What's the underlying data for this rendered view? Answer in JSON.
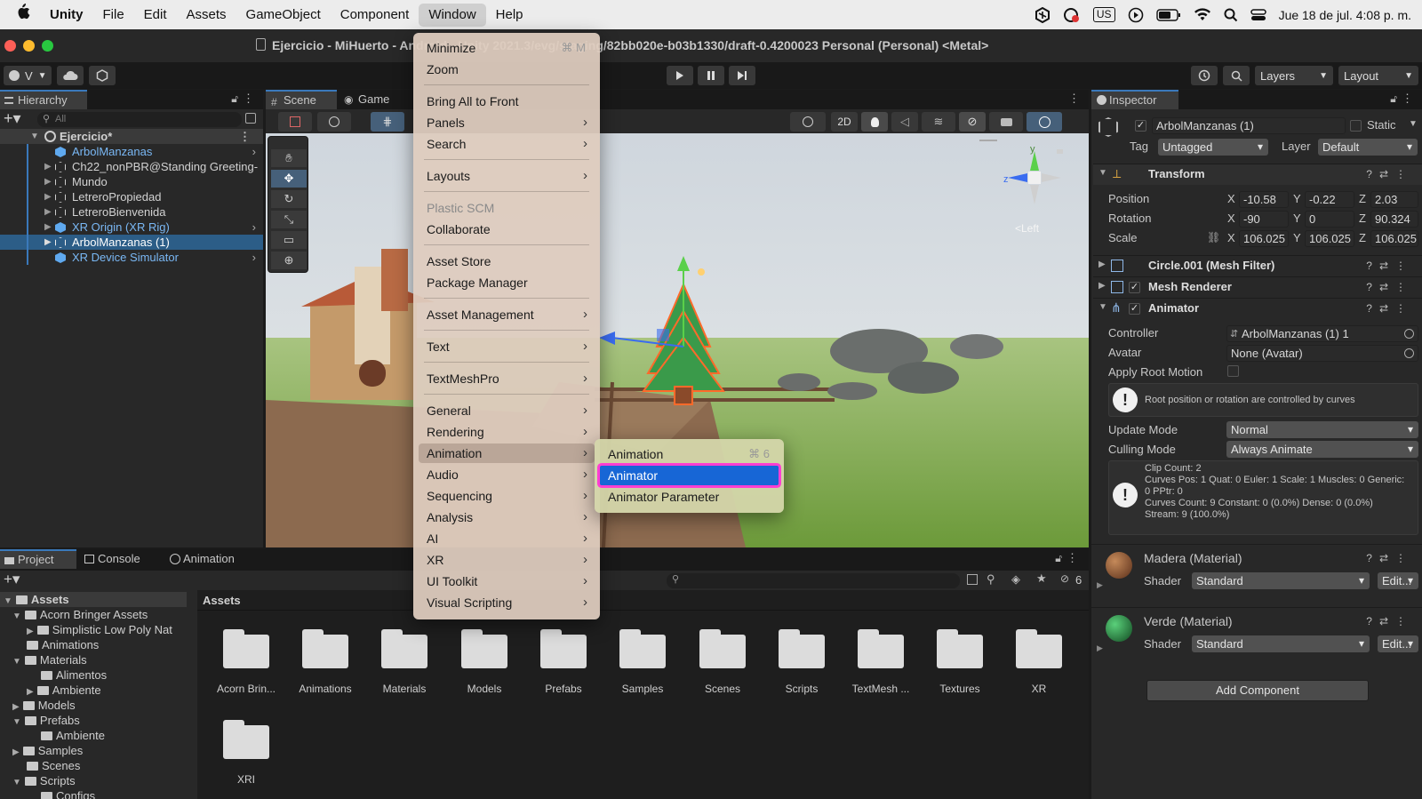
{
  "menubar": {
    "apple": "",
    "app": "Unity",
    "items": [
      "File",
      "Edit",
      "Assets",
      "GameObject",
      "Component",
      "Window",
      "Help"
    ],
    "keyboard": "US",
    "datetime": "Jue 18 de jul.  4:08 p. m."
  },
  "window": {
    "title": "Ejercicio - MiHuerto - Android - Unity 2021.3/evg/staging/82bb020e-b03b1330/draft-0.4200023 Personal (Personal) <Metal>"
  },
  "toolbar": {
    "account": "V",
    "layers": "Layers",
    "layout": "Layout"
  },
  "hierarchy": {
    "tab": "Hierarchy",
    "search_placeholder": "All",
    "scene": "Ejercicio*",
    "items": [
      {
        "label": "ArbolManzanas"
      },
      {
        "label": "Ch22_nonPBR@Standing Greeting-"
      },
      {
        "label": "Mundo"
      },
      {
        "label": "LetreroPropiedad"
      },
      {
        "label": "LetreroBienvenida"
      },
      {
        "label": "XR Origin (XR Rig)"
      },
      {
        "label": "ArbolManzanas (1)"
      },
      {
        "label": "XR Device Simulator"
      }
    ]
  },
  "scene_tabs": {
    "scene": "Scene",
    "game": "Game",
    "mode_2d": "2D",
    "gizmo_left": "<Left",
    "gizmo_y": "y",
    "gizmo_z": "z"
  },
  "window_menu": {
    "items": [
      {
        "label": "Minimize",
        "shortcut": "⌘ M"
      },
      {
        "label": "Zoom"
      },
      {
        "label": "Bring All to Front"
      },
      {
        "label": "Panels"
      },
      {
        "label": "Search"
      },
      {
        "label": "Layouts"
      },
      {
        "label": "Plastic SCM"
      },
      {
        "label": "Collaborate"
      },
      {
        "label": "Asset Store"
      },
      {
        "label": "Package Manager"
      },
      {
        "label": "Asset Management"
      },
      {
        "label": "Text"
      },
      {
        "label": "TextMeshPro"
      },
      {
        "label": "General"
      },
      {
        "label": "Rendering"
      },
      {
        "label": "Animation"
      },
      {
        "label": "Audio"
      },
      {
        "label": "Sequencing"
      },
      {
        "label": "Analysis"
      },
      {
        "label": "AI"
      },
      {
        "label": "XR"
      },
      {
        "label": "UI Toolkit"
      },
      {
        "label": "Visual Scripting"
      }
    ]
  },
  "animation_submenu": {
    "items": [
      {
        "label": "Animation",
        "shortcut": "⌘ 6"
      },
      {
        "label": "Animator"
      },
      {
        "label": "Animator Parameter"
      }
    ],
    "highlight_color": "#ff3ed2"
  },
  "inspector": {
    "tab": "Inspector",
    "object_name": "ArbolManzanas (1)",
    "static_label": "Static",
    "tag_label": "Tag",
    "tag_value": "Untagged",
    "layer_label": "Layer",
    "layer_value": "Default",
    "transform": {
      "title": "Transform",
      "position_label": "Position",
      "rotation_label": "Rotation",
      "scale_label": "Scale",
      "position": [
        "-10.58",
        "-0.22",
        "2.03"
      ],
      "rotation": [
        "-90",
        "0",
        "90.324"
      ],
      "scale": [
        "106.025",
        "106.025",
        "106.025"
      ],
      "axes": [
        "X",
        "Y",
        "Z"
      ]
    },
    "mesh_filter": "Circle.001 (Mesh Filter)",
    "mesh_renderer": "Mesh Renderer",
    "animator": {
      "title": "Animator",
      "controller_label": "Controller",
      "controller_value": "ArbolManzanas (1) 1",
      "avatar_label": "Avatar",
      "avatar_value": "None (Avatar)",
      "root_motion_label": "Apply Root Motion",
      "info1": "Root position or rotation are controlled by curves",
      "update_label": "Update Mode",
      "update_value": "Normal",
      "culling_label": "Culling Mode",
      "culling_value": "Always Animate",
      "info2_lines": [
        "Clip Count: 2",
        "Curves Pos: 1 Quat: 0 Euler: 1 Scale: 1 Muscles: 0 Generic:",
        "0 PPtr: 0",
        "Curves Count: 9 Constant: 0 (0.0%) Dense: 0 (0.0%)",
        "Stream: 9 (100.0%)"
      ]
    },
    "materials": [
      {
        "name": "Madera (Material)",
        "shader_label": "Shader",
        "shader": "Standard",
        "edit": "Edit..."
      },
      {
        "name": "Verde (Material)",
        "shader_label": "Shader",
        "shader": "Standard",
        "edit": "Edit..."
      }
    ],
    "add_component": "Add Component"
  },
  "bottom_tabs": {
    "project": "Project",
    "console": "Console",
    "animation": "Animation"
  },
  "project": {
    "tree": [
      {
        "label": "Assets"
      },
      {
        "label": "Acorn Bringer Assets"
      },
      {
        "label": "Simplistic Low Poly Nat"
      },
      {
        "label": "Animations"
      },
      {
        "label": "Materials"
      },
      {
        "label": "Alimentos"
      },
      {
        "label": "Ambiente"
      },
      {
        "label": "Models"
      },
      {
        "label": "Prefabs"
      },
      {
        "label": "Ambiente"
      },
      {
        "label": "Samples"
      },
      {
        "label": "Scenes"
      },
      {
        "label": "Scripts"
      },
      {
        "label": "Configs"
      }
    ],
    "breadcrumb": "Assets",
    "hidden_count": "6",
    "folders": [
      "Acorn Brin...",
      "Animations",
      "Materials",
      "Models",
      "Prefabs",
      "Samples",
      "Scenes",
      "Scripts",
      "TextMesh ...",
      "Textures",
      "XR",
      "XRI"
    ]
  }
}
